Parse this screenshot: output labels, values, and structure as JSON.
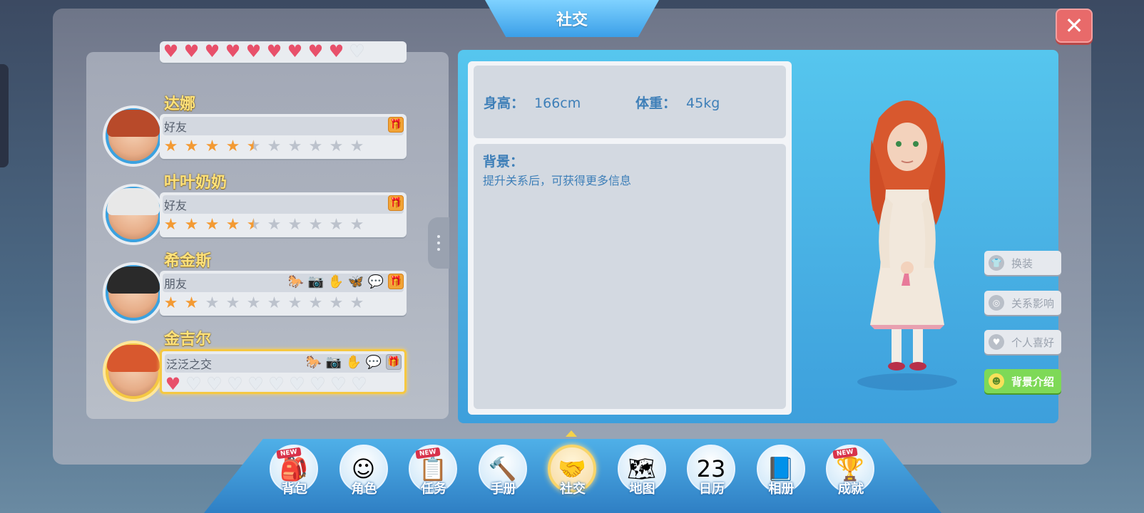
{
  "window": {
    "title": "社交",
    "close_label": "✕"
  },
  "friends": [
    {
      "name": "",
      "relation": "",
      "meter": "hearts",
      "filled": 8.5,
      "total": 10,
      "icons": []
    },
    {
      "name": "达娜",
      "relation": "好友",
      "meter": "stars",
      "filled": 4.5,
      "total": 10,
      "icons": [
        "gift"
      ]
    },
    {
      "name": "叶叶奶奶",
      "relation": "好友",
      "meter": "stars",
      "filled": 4.5,
      "total": 10,
      "icons": [
        "gift"
      ]
    },
    {
      "name": "希金斯",
      "relation": "朋友",
      "meter": "stars",
      "filled": 2,
      "total": 10,
      "icons": [
        "horse",
        "camera",
        "glove",
        "butterfly",
        "bubble",
        "gift"
      ]
    },
    {
      "name": "金吉尔",
      "relation": "泛泛之交",
      "meter": "hearts",
      "filled": 0.5,
      "total": 10,
      "icons": [
        "horse",
        "camera",
        "glove",
        "bubble",
        "gift"
      ],
      "selected": true
    }
  ],
  "profile": {
    "height_label": "身高：",
    "height_value": "166cm",
    "weight_label": "体重：",
    "weight_value": "45kg",
    "background_title": "背景：",
    "background_text": "提升关系后，可获得更多信息"
  },
  "side_buttons": [
    {
      "label": "换装",
      "icon": "shirt-icon",
      "active": false
    },
    {
      "label": "关系影响",
      "icon": "swirl-icon",
      "active": false
    },
    {
      "label": "个人喜好",
      "icon": "heart-icon",
      "active": false
    },
    {
      "label": "背景介绍",
      "icon": "person-icon",
      "active": true
    }
  ],
  "nav": [
    {
      "label": "背包",
      "icon": "backpack-icon",
      "glyph": "🎒",
      "new": true
    },
    {
      "label": "角色",
      "icon": "character-icon",
      "glyph": "☺",
      "new": false
    },
    {
      "label": "任务",
      "icon": "tasks-icon",
      "glyph": "📋",
      "new": true
    },
    {
      "label": "手册",
      "icon": "hammer-icon",
      "glyph": "🔨",
      "new": false
    },
    {
      "label": "社交",
      "icon": "handshake-icon",
      "glyph": "🤝",
      "new": false,
      "active": true
    },
    {
      "label": "地图",
      "icon": "map-icon",
      "glyph": "🗺",
      "new": false
    },
    {
      "label": "日历",
      "icon": "calendar-icon",
      "glyph": "23",
      "new": false
    },
    {
      "label": "相册",
      "icon": "album-icon",
      "glyph": "📘",
      "new": false
    },
    {
      "label": "成就",
      "icon": "trophy-icon",
      "glyph": "🏆",
      "new": true
    }
  ],
  "new_badge": "NEW",
  "colors": {
    "accent": "#3d9fdc",
    "gold": "#ffe27a",
    "star": "#f39a33",
    "heart": "#e8506a",
    "active_green": "#7ed957",
    "close_red": "#e86a6a"
  }
}
